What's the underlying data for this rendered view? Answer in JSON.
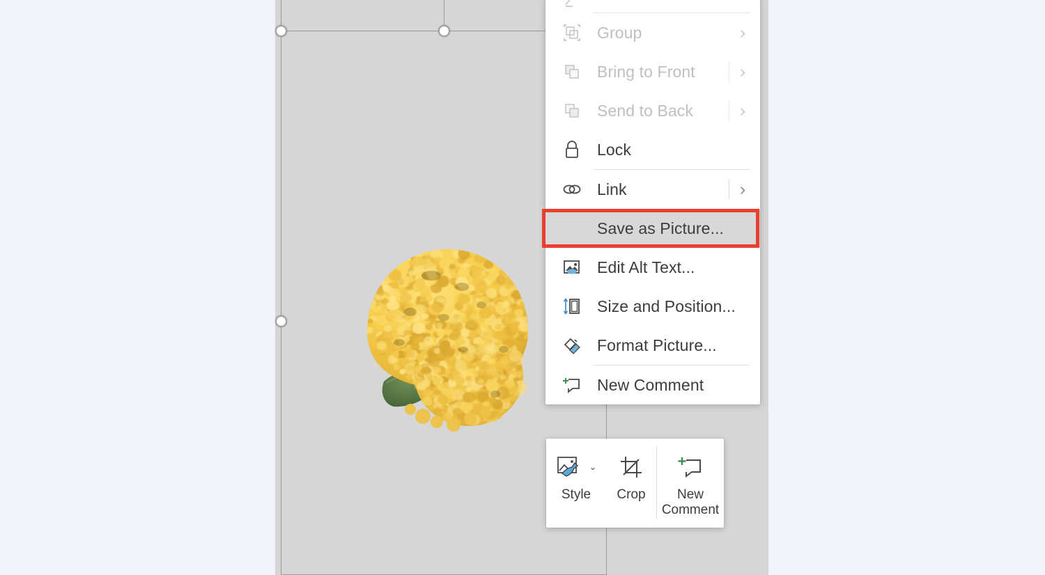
{
  "app": {
    "surface_label": "powerpoint-slide-editing-surface",
    "background_color": "#f2f2fb",
    "slide_color": "#d6d6d6"
  },
  "slide": {
    "picture_alt": "Yellow ball-shaped chrysanthemum flower with green leaf",
    "selection_label": "Picture selection frame with resize handles"
  },
  "context_menu": {
    "highlight_color": "#e8402f",
    "items": [
      {
        "id": "partial_top",
        "label": "",
        "icon": "partial-row-icon",
        "disabled": true,
        "submenu": false,
        "partial": true
      },
      {
        "id": "group",
        "label": "Group",
        "accel": "G",
        "icon": "group-icon",
        "disabled": true,
        "submenu": true,
        "divider_before": true
      },
      {
        "id": "bring_to_front",
        "label": "Bring to Front",
        "accel": "r",
        "icon": "bring-to-front-icon",
        "disabled": true,
        "submenu": true
      },
      {
        "id": "send_to_back",
        "label": "Send to Back",
        "accel": "k",
        "icon": "send-to-back-icon",
        "disabled": true,
        "submenu": true
      },
      {
        "id": "lock",
        "label": "Lock",
        "accel": "L",
        "icon": "lock-icon",
        "disabled": false,
        "submenu": false
      },
      {
        "id": "link",
        "label": "Link",
        "accel": "i",
        "icon": "link-icon",
        "disabled": false,
        "submenu": true,
        "divider_before": true
      },
      {
        "id": "save_as_picture",
        "label": "Save as Picture...",
        "accel": "S",
        "icon": "",
        "disabled": false,
        "submenu": false,
        "highlighted": true
      },
      {
        "id": "edit_alt_text",
        "label": "Edit Alt Text...",
        "accel": "A",
        "icon": "alt-text-icon",
        "disabled": false,
        "submenu": false
      },
      {
        "id": "size_and_position",
        "label": "Size and Position...",
        "accel": "z",
        "icon": "size-position-icon",
        "disabled": false,
        "submenu": false
      },
      {
        "id": "format_picture",
        "label": "Format Picture...",
        "accel": "o",
        "icon": "format-picture-icon",
        "disabled": false,
        "submenu": false
      },
      {
        "id": "new_comment",
        "label": "New Comment",
        "accel": "m",
        "icon": "new-comment-icon",
        "disabled": false,
        "submenu": false,
        "divider_before": true
      }
    ],
    "chevron_glyph": "›"
  },
  "mini_toolbar": {
    "style_label": "Style",
    "crop_label": "Crop",
    "new_comment_label": "New\nComment",
    "new_comment_line1": "New",
    "new_comment_line2": "Comment",
    "dropdown_glyph": "⌄"
  }
}
